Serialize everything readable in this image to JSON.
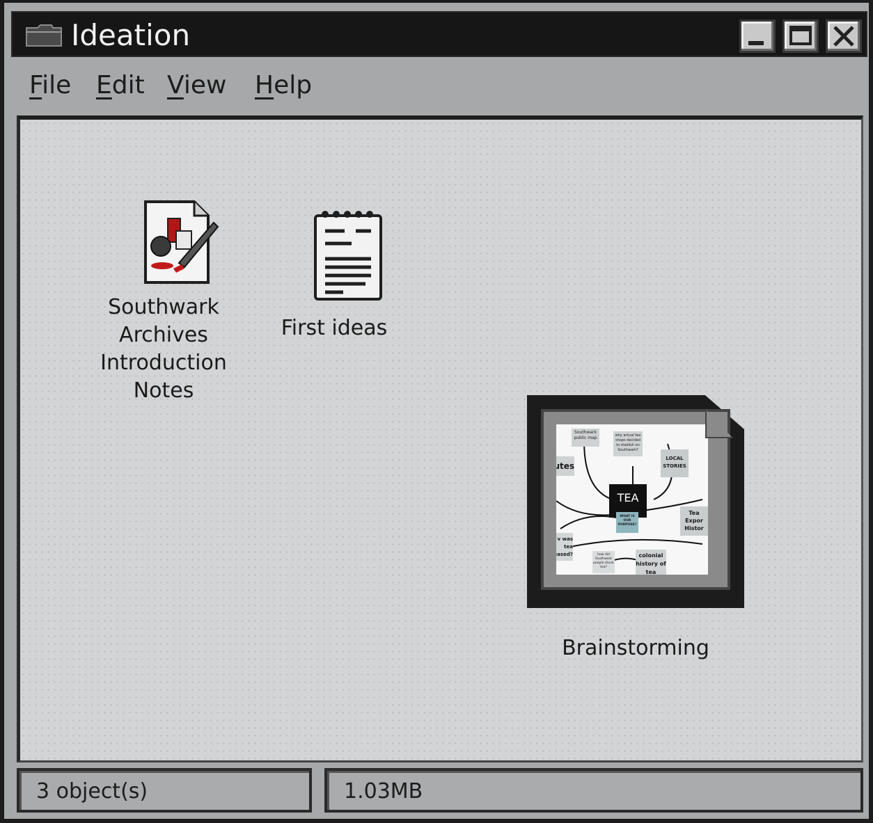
{
  "window": {
    "title": "Ideation",
    "icons": {
      "folder": "folder-icon",
      "minimize": "minimize-icon",
      "maximize": "maximize-icon",
      "close": "close-icon"
    }
  },
  "menu": [
    {
      "label": "File",
      "accel": "F",
      "rest": "ile"
    },
    {
      "label": "Edit",
      "accel": "E",
      "rest": "dit"
    },
    {
      "label": "View",
      "accel": "V",
      "rest": "iew"
    },
    {
      "label": "Help",
      "accel": "H",
      "rest": "elp"
    }
  ],
  "files": [
    {
      "label": "Southwark\nArchives\nIntroduction\nNotes",
      "icon": "paint-document-icon"
    },
    {
      "label": "First ideas",
      "icon": "notepad-icon"
    },
    {
      "label": "Brainstorming",
      "icon": "mindmap-thumbnail-icon"
    }
  ],
  "thumbnail": {
    "center": "TEA",
    "purpose": "WHAT IS OUR PURPOSE?",
    "notes": [
      "Southwark public map",
      "why actual tea shops decided to stablish on Southwark?",
      "LOCAL STORIES",
      "utes",
      "Tea Expor Histor",
      "v was tea eased?",
      "how did Southwark people drunk tea?",
      "colonial history of tea"
    ]
  },
  "status": {
    "objects": "3 object(s)",
    "size": "1.03MB"
  }
}
